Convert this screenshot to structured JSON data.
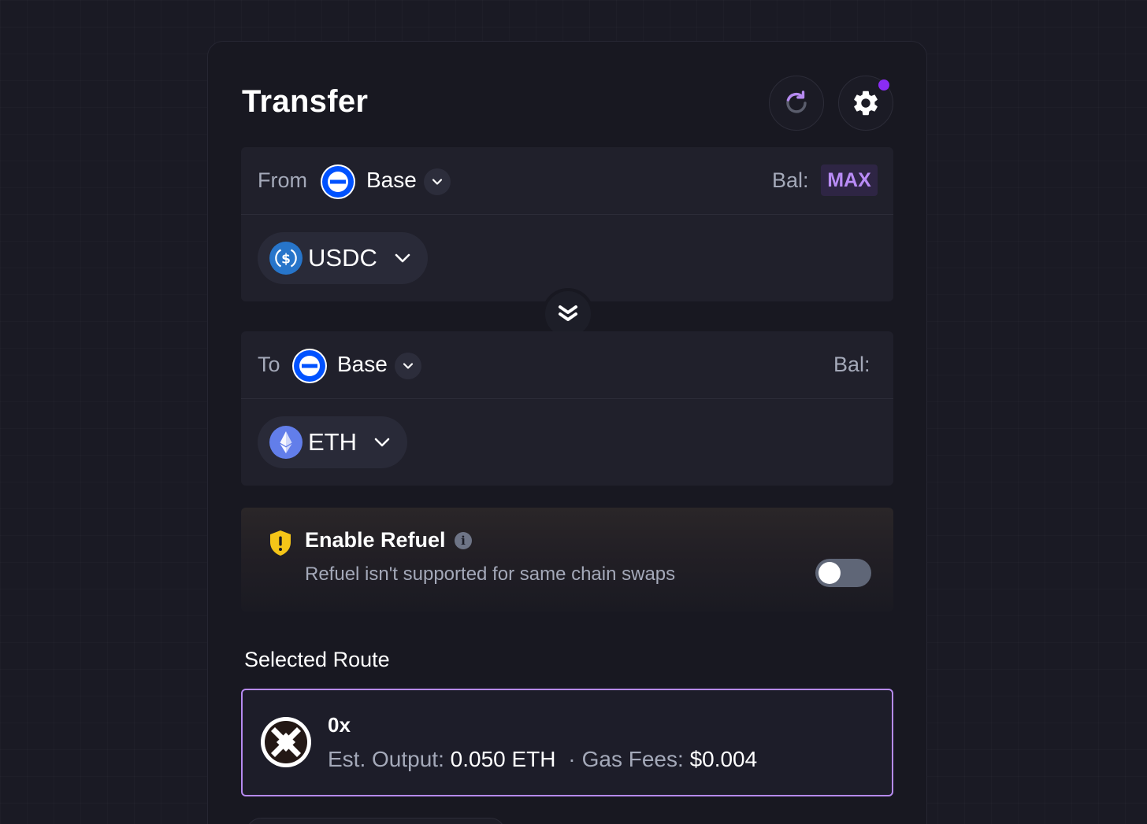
{
  "header": {
    "title": "Transfer",
    "refresh_icon": "refresh-icon",
    "settings_icon": "gear-icon",
    "settings_notification": true
  },
  "from": {
    "label": "From",
    "chain": "Base",
    "balance_label": "Bal:",
    "max_label": "MAX",
    "token": "USDC"
  },
  "to": {
    "label": "To",
    "chain": "Base",
    "balance_label": "Bal:",
    "token": "ETH"
  },
  "refuel": {
    "title": "Enable Refuel",
    "info_symbol": "i",
    "subtitle": "Refuel isn't supported for same chain swaps",
    "enabled": false
  },
  "route": {
    "heading": "Selected Route",
    "provider": "0x",
    "output_label": "Est. Output:",
    "output_value": "0.050 ETH",
    "separator": "·",
    "gas_label": "Gas Fees:",
    "gas_value": "$0.004"
  },
  "colors": {
    "accent": "#b68af0",
    "notification": "#8b2cf5",
    "base_chain": "#0052ff",
    "usdc": "#2775ca",
    "eth": "#627eea",
    "warning": "#f5c518"
  }
}
